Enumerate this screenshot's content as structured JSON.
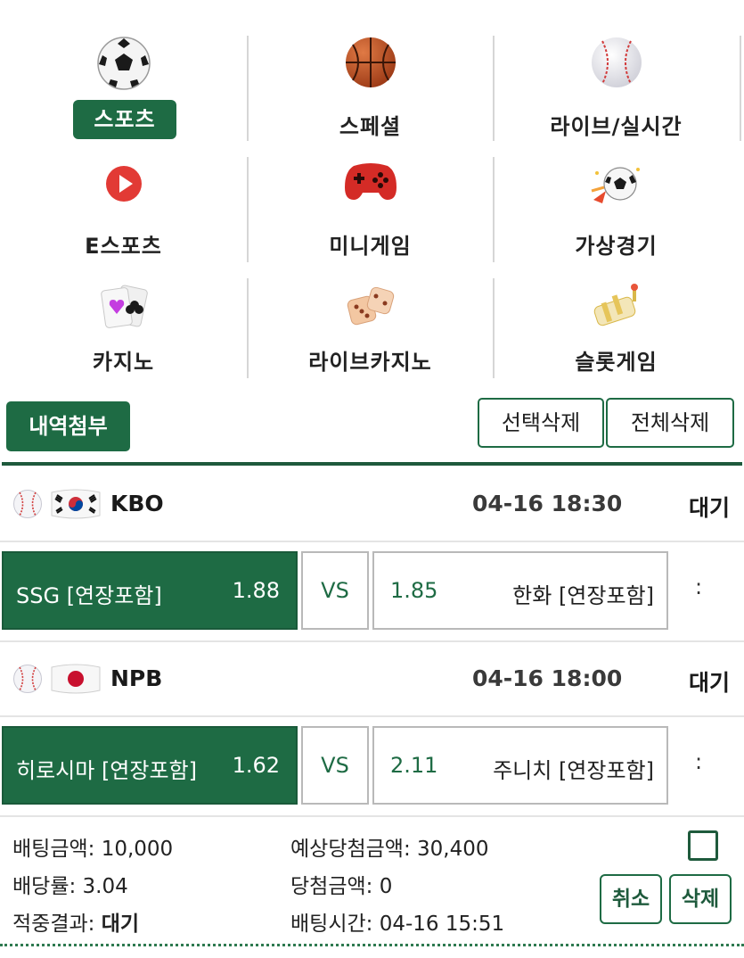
{
  "categories": [
    {
      "label": "스포츠",
      "icon": "soccer-ball-icon",
      "active": true
    },
    {
      "label": "스페셜",
      "icon": "basketball-icon"
    },
    {
      "label": "라이브/실시간",
      "icon": "baseball-icon"
    },
    {
      "label": "E스포츠",
      "icon": "play-icon"
    },
    {
      "label": "미니게임",
      "icon": "gamepad-icon"
    },
    {
      "label": "가상경기",
      "icon": "virtual-ball-icon"
    },
    {
      "label": "카지노",
      "icon": "cards-icon"
    },
    {
      "label": "라이브카지노",
      "icon": "dice-icon"
    },
    {
      "label": "슬롯게임",
      "icon": "slot-reel-icon"
    }
  ],
  "toolbar": {
    "history_label": "내역첨부",
    "delete_selected_label": "선택삭제",
    "delete_all_label": "전체삭제"
  },
  "bets": [
    {
      "league": "KBO",
      "flag": "korea-flag-icon",
      "time": "04-16 18:30",
      "status": "대기",
      "home_team": "SSG [연장포함]",
      "home_odd": "1.88",
      "vs_label": "VS",
      "away_odd": "1.85",
      "away_team": "한화 [연장포함]",
      "score": ":"
    },
    {
      "league": "NPB",
      "flag": "japan-flag-icon",
      "time": "04-16 18:00",
      "status": "대기",
      "home_team": "히로시마 [연장포함]",
      "home_odd": "1.62",
      "vs_label": "VS",
      "away_odd": "2.11",
      "away_team": "주니치 [연장포함]",
      "score": ":"
    }
  ],
  "summary": {
    "bet_amount_label": "배팅금액:",
    "bet_amount": "10,000",
    "expected_win_label": "예상당첨금액:",
    "expected_win": "30,400",
    "odds_label": "배당률:",
    "odds": "3.04",
    "win_amount_label": "당첨금액:",
    "win_amount": "0",
    "result_label": "적중결과:",
    "result": "대기",
    "bet_time_label": "배팅시간:",
    "bet_time": "04-16 15:51",
    "cancel_label": "취소",
    "delete_label": "삭제"
  },
  "colors": {
    "brand_green": "#1e6b44",
    "dark_green": "#1e5a3c",
    "divider": "#d6d6d6"
  }
}
